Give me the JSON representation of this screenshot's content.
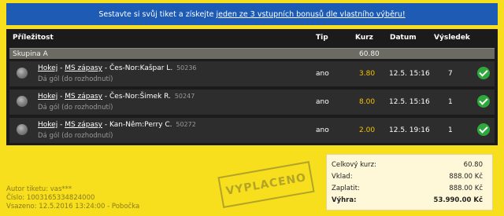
{
  "banner": {
    "text": "Sestavte si svůj tiket a získejte",
    "link": "jeden ze 3 vstupních bonusů dle vlastního výběru!"
  },
  "table": {
    "headers": {
      "event": "Příležitost",
      "tip": "Tip",
      "kurz": "Kurz",
      "datum": "Datum",
      "vysledek": "Výsledek"
    },
    "group": {
      "name": "Skupina A",
      "kurz": "60.80"
    },
    "rows": [
      {
        "sport": "Hokej",
        "competition": "MS zápasy",
        "event": "Čes-Nor:Kašpar L.",
        "id": "50236",
        "market": "Dá gól (do rozhodnutí)",
        "tip": "ano",
        "kurz": "3.80",
        "datum": "12.5. 15:16",
        "vysledek": "7"
      },
      {
        "sport": "Hokej",
        "competition": "MS zápasy",
        "event": "Čes-Nor:Šimek R.",
        "id": "50247",
        "market": "Dá gól (do rozhodnutí)",
        "tip": "ano",
        "kurz": "8.00",
        "datum": "12.5. 15:16",
        "vysledek": "1"
      },
      {
        "sport": "Hokej",
        "competition": "MS zápasy",
        "event": "Kan-Něm:Perry C.",
        "id": "50272",
        "market": "Dá gól (do rozhodnutí)",
        "tip": "ano",
        "kurz": "2.00",
        "datum": "12.5. 19:16",
        "vysledek": "1"
      }
    ]
  },
  "info": {
    "author": "Autor tiketu: vas***",
    "number": "Číslo: 1003165334824000",
    "placed": "Vsazeno: 12.5.2016 13:24:00 - Pobočka"
  },
  "stamp": "VYPLACENO",
  "summary": {
    "total_odds_label": "Celkový kurz:",
    "total_odds": "60.80",
    "stake_label": "Vklad:",
    "stake": "888.00 Kč",
    "paid_label": "Zaplatit:",
    "paid": "888.00 Kč",
    "win_label": "Výhra:",
    "win": "53.990.00 Kč"
  },
  "colors": {
    "banner": "#1d5bb5",
    "background": "#f7df1e",
    "table": "#1b1b1b",
    "odds": "#f3c300",
    "win_check": "#2ea83b"
  },
  "icons": {
    "sport": "hockey-puck-icon",
    "result": "checkmark-icon"
  }
}
